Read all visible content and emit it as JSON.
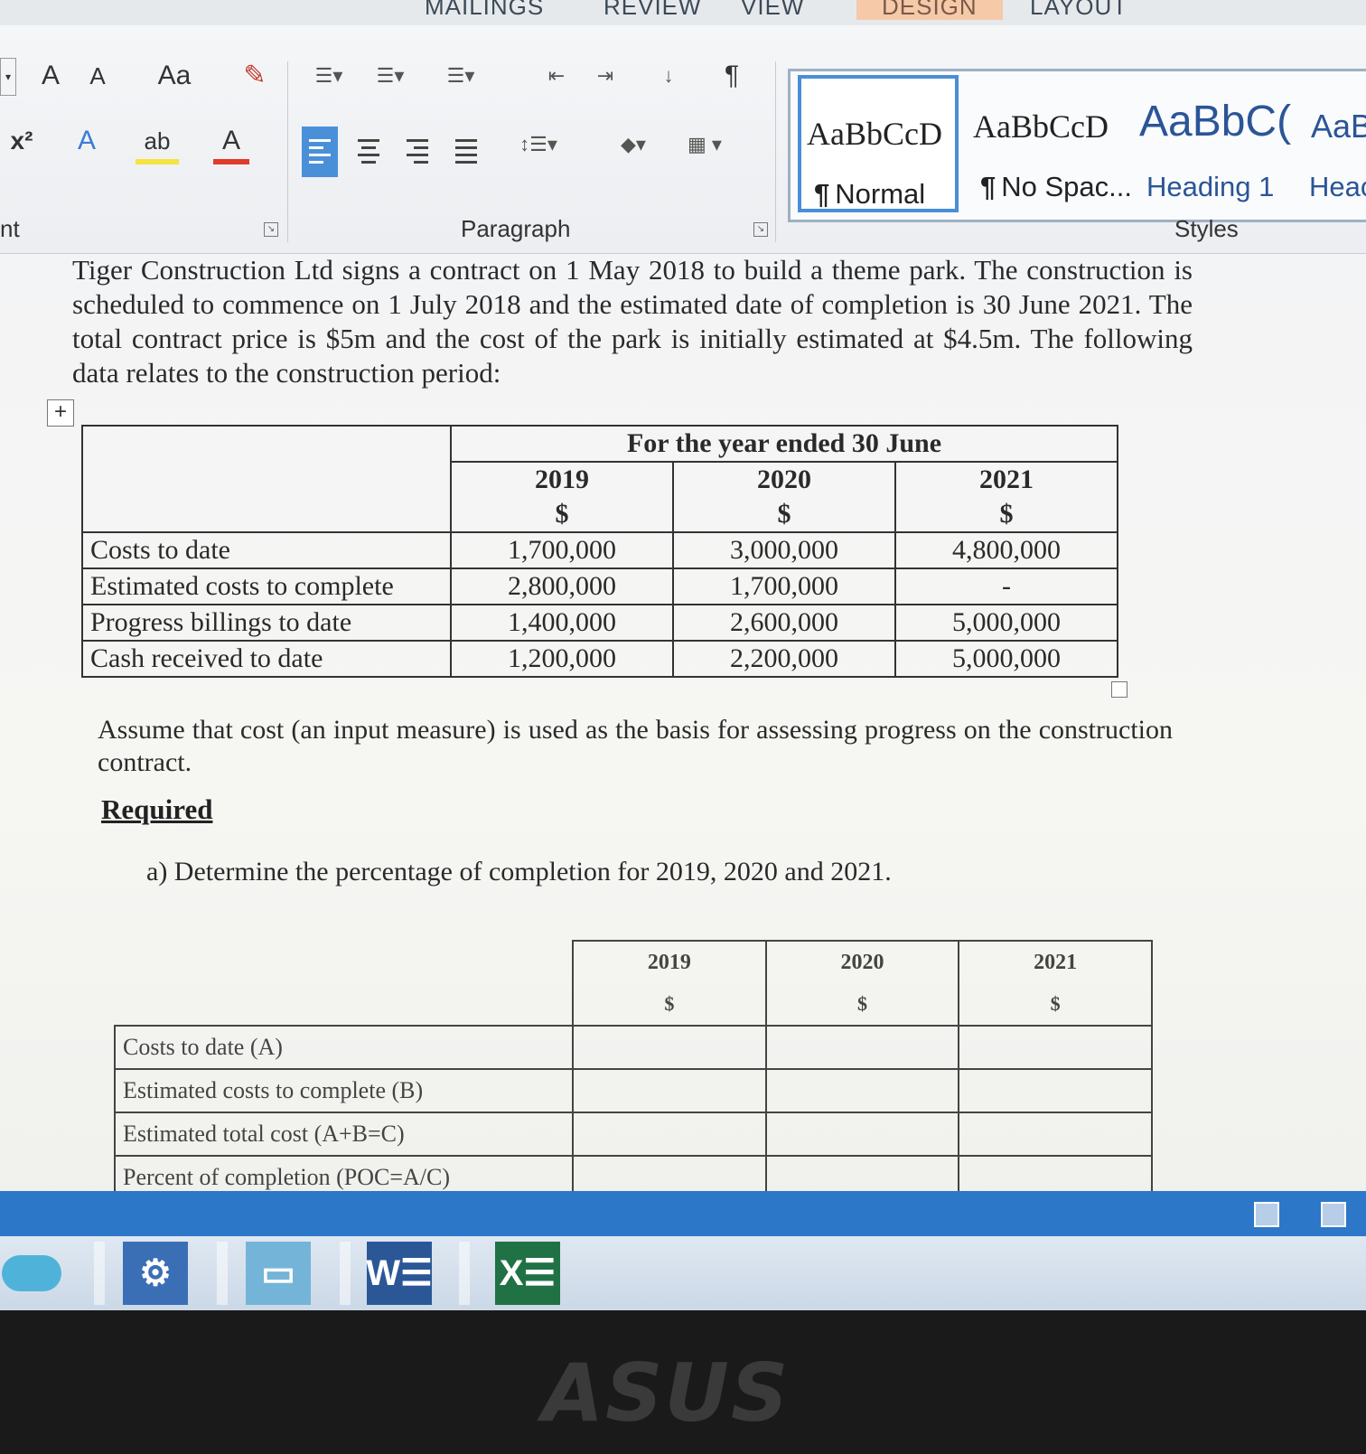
{
  "ribbon": {
    "tabs": [
      "MAILINGS",
      "REVIEW",
      "VIEW",
      "DESIGN",
      "LAYOUT"
    ],
    "font_group": {
      "grow_label": "A",
      "shrink_label": "A",
      "change_case_label": "Aa",
      "superscript_label": "x²",
      "text_effects_label": "A",
      "highlight_label": "ab",
      "font_color_label": "A"
    },
    "font_group_label_partial": "nt",
    "paragraph_label": "Paragraph",
    "styles_label": "Styles",
    "styles": [
      {
        "sample": "AaBbCcD",
        "name": "Normal",
        "pilcrow": "¶",
        "selected": true
      },
      {
        "sample": "AaBbCcD",
        "name": "No Spac...",
        "pilcrow": "¶",
        "selected": false
      },
      {
        "sample": "AaBbC(",
        "name": "Heading 1",
        "pilcrow": "",
        "selected": false
      },
      {
        "sample": "AaB",
        "name": "Heac",
        "pilcrow": "",
        "selected": false
      }
    ]
  },
  "document": {
    "intro": "Tiger Construction Ltd signs a contract on 1 May 2018 to build a theme park. The construction is scheduled to commence on 1 July 2018 and the estimated date of completion is 30 June 2021. The total contract price is $5m and the cost of the park is initially estimated at $4.5m. The following data relates to the construction period:",
    "table1": {
      "group_header": "For the year ended 30 June",
      "years": [
        "2019",
        "2020",
        "2021"
      ],
      "currency": "$",
      "rows": [
        {
          "label": "Costs to date",
          "values": [
            "1,700,000",
            "3,000,000",
            "4,800,000"
          ]
        },
        {
          "label": "Estimated costs to complete",
          "values": [
            "2,800,000",
            "1,700,000",
            "-"
          ]
        },
        {
          "label": "Progress billings to date",
          "values": [
            "1,400,000",
            "2,600,000",
            "5,000,000"
          ]
        },
        {
          "label": "Cash received to date",
          "values": [
            "1,200,000",
            "2,200,000",
            "5,000,000"
          ]
        }
      ]
    },
    "assumption": "Assume that cost (an input measure) is used as the basis for assessing progress on the construction contract.",
    "required_heading": "Required",
    "question_a": "a) Determine the percentage of completion for 2019, 2020 and 2021.",
    "table2": {
      "years": [
        "2019",
        "2020",
        "2021"
      ],
      "currency": "$",
      "rows": [
        "Costs to date (A)",
        "Estimated costs to complete (B)",
        "Estimated total cost (A+B=C)",
        "Percent of completion (POC=A/C)"
      ]
    }
  },
  "taskbar": {
    "word_label": "W",
    "excel_label": "X"
  },
  "bezel": {
    "brand": "ASUS"
  },
  "colors": {
    "statusbar": "#2c77c8",
    "selected_align": "#4a90d9",
    "heading_style": "#2a5597",
    "word": "#2b5797",
    "excel": "#207245"
  }
}
